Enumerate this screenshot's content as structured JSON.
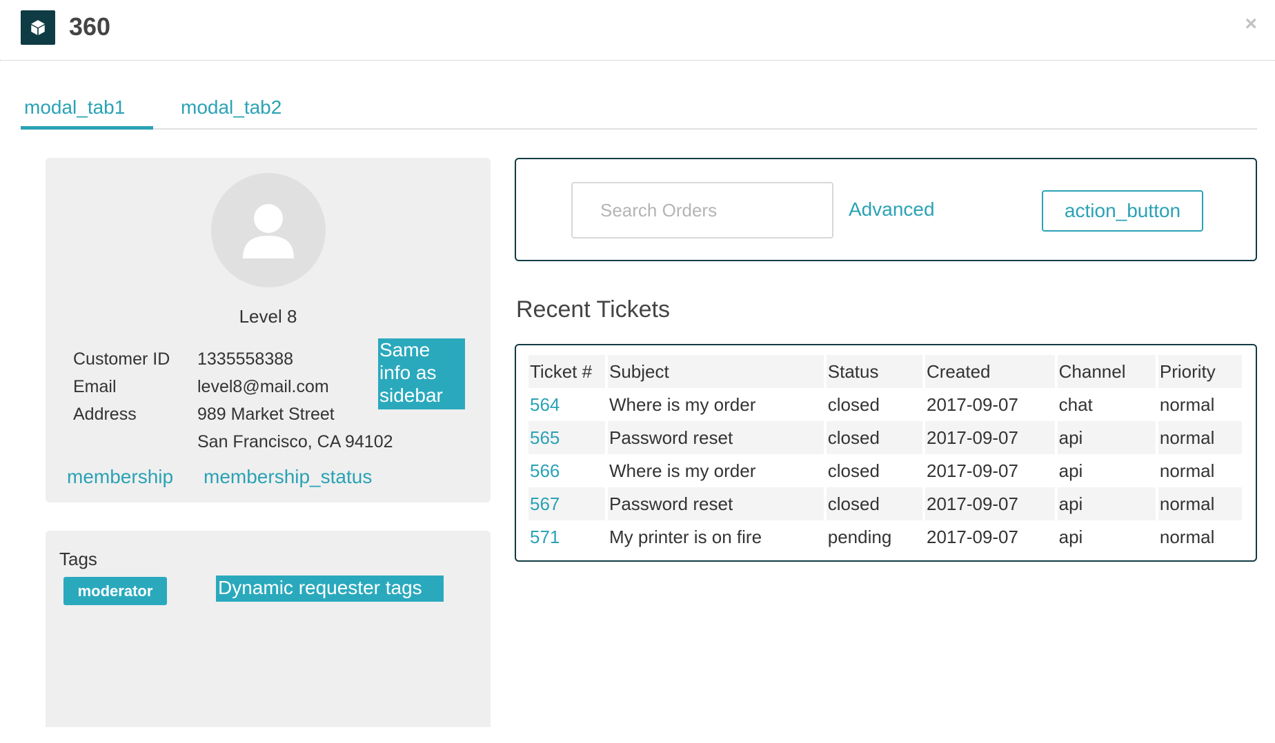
{
  "header": {
    "title": "360",
    "logo_icon": "cube-icon",
    "close_label": "×"
  },
  "tabs": [
    {
      "label": "modal_tab1",
      "active": true
    },
    {
      "label": "modal_tab2",
      "active": false
    }
  ],
  "profile": {
    "level": "Level 8",
    "fields": [
      {
        "label": "Customer ID",
        "value": "1335558388"
      },
      {
        "label": "Email",
        "value": "level8@mail.com"
      },
      {
        "label": "Address",
        "value": "989 Market Street",
        "value2": "San Francisco, CA 94102"
      }
    ],
    "sidebar_note": "Same info as sidebar",
    "links": [
      "membership",
      "membership_status"
    ]
  },
  "tags": {
    "title": "Tags",
    "items": [
      "moderator"
    ],
    "dynamic_note": "Dynamic requester tags"
  },
  "search": {
    "placeholder": "Search Orders",
    "value": "",
    "advanced_label": "Advanced",
    "action_label": "action_button"
  },
  "tickets": {
    "title": "Recent Tickets",
    "columns": [
      "Ticket #",
      "Subject",
      "Status",
      "Created",
      "Channel",
      "Priority"
    ],
    "rows": [
      [
        "564",
        "Where is my order",
        "closed",
        "2017-09-07",
        "chat",
        "normal"
      ],
      [
        "565",
        "Password reset",
        "closed",
        "2017-09-07",
        "api",
        "normal"
      ],
      [
        "566",
        "Where is my order",
        "closed",
        "2017-09-07",
        "api",
        "normal"
      ],
      [
        "567",
        "Password reset",
        "closed",
        "2017-09-07",
        "api",
        "normal"
      ],
      [
        "571",
        "My printer is on fire",
        "pending",
        "2017-09-07",
        "api",
        "normal"
      ]
    ]
  },
  "colors": {
    "accent": "#2aa2b5",
    "dark": "#0f3b44",
    "panel": "#efefef"
  }
}
